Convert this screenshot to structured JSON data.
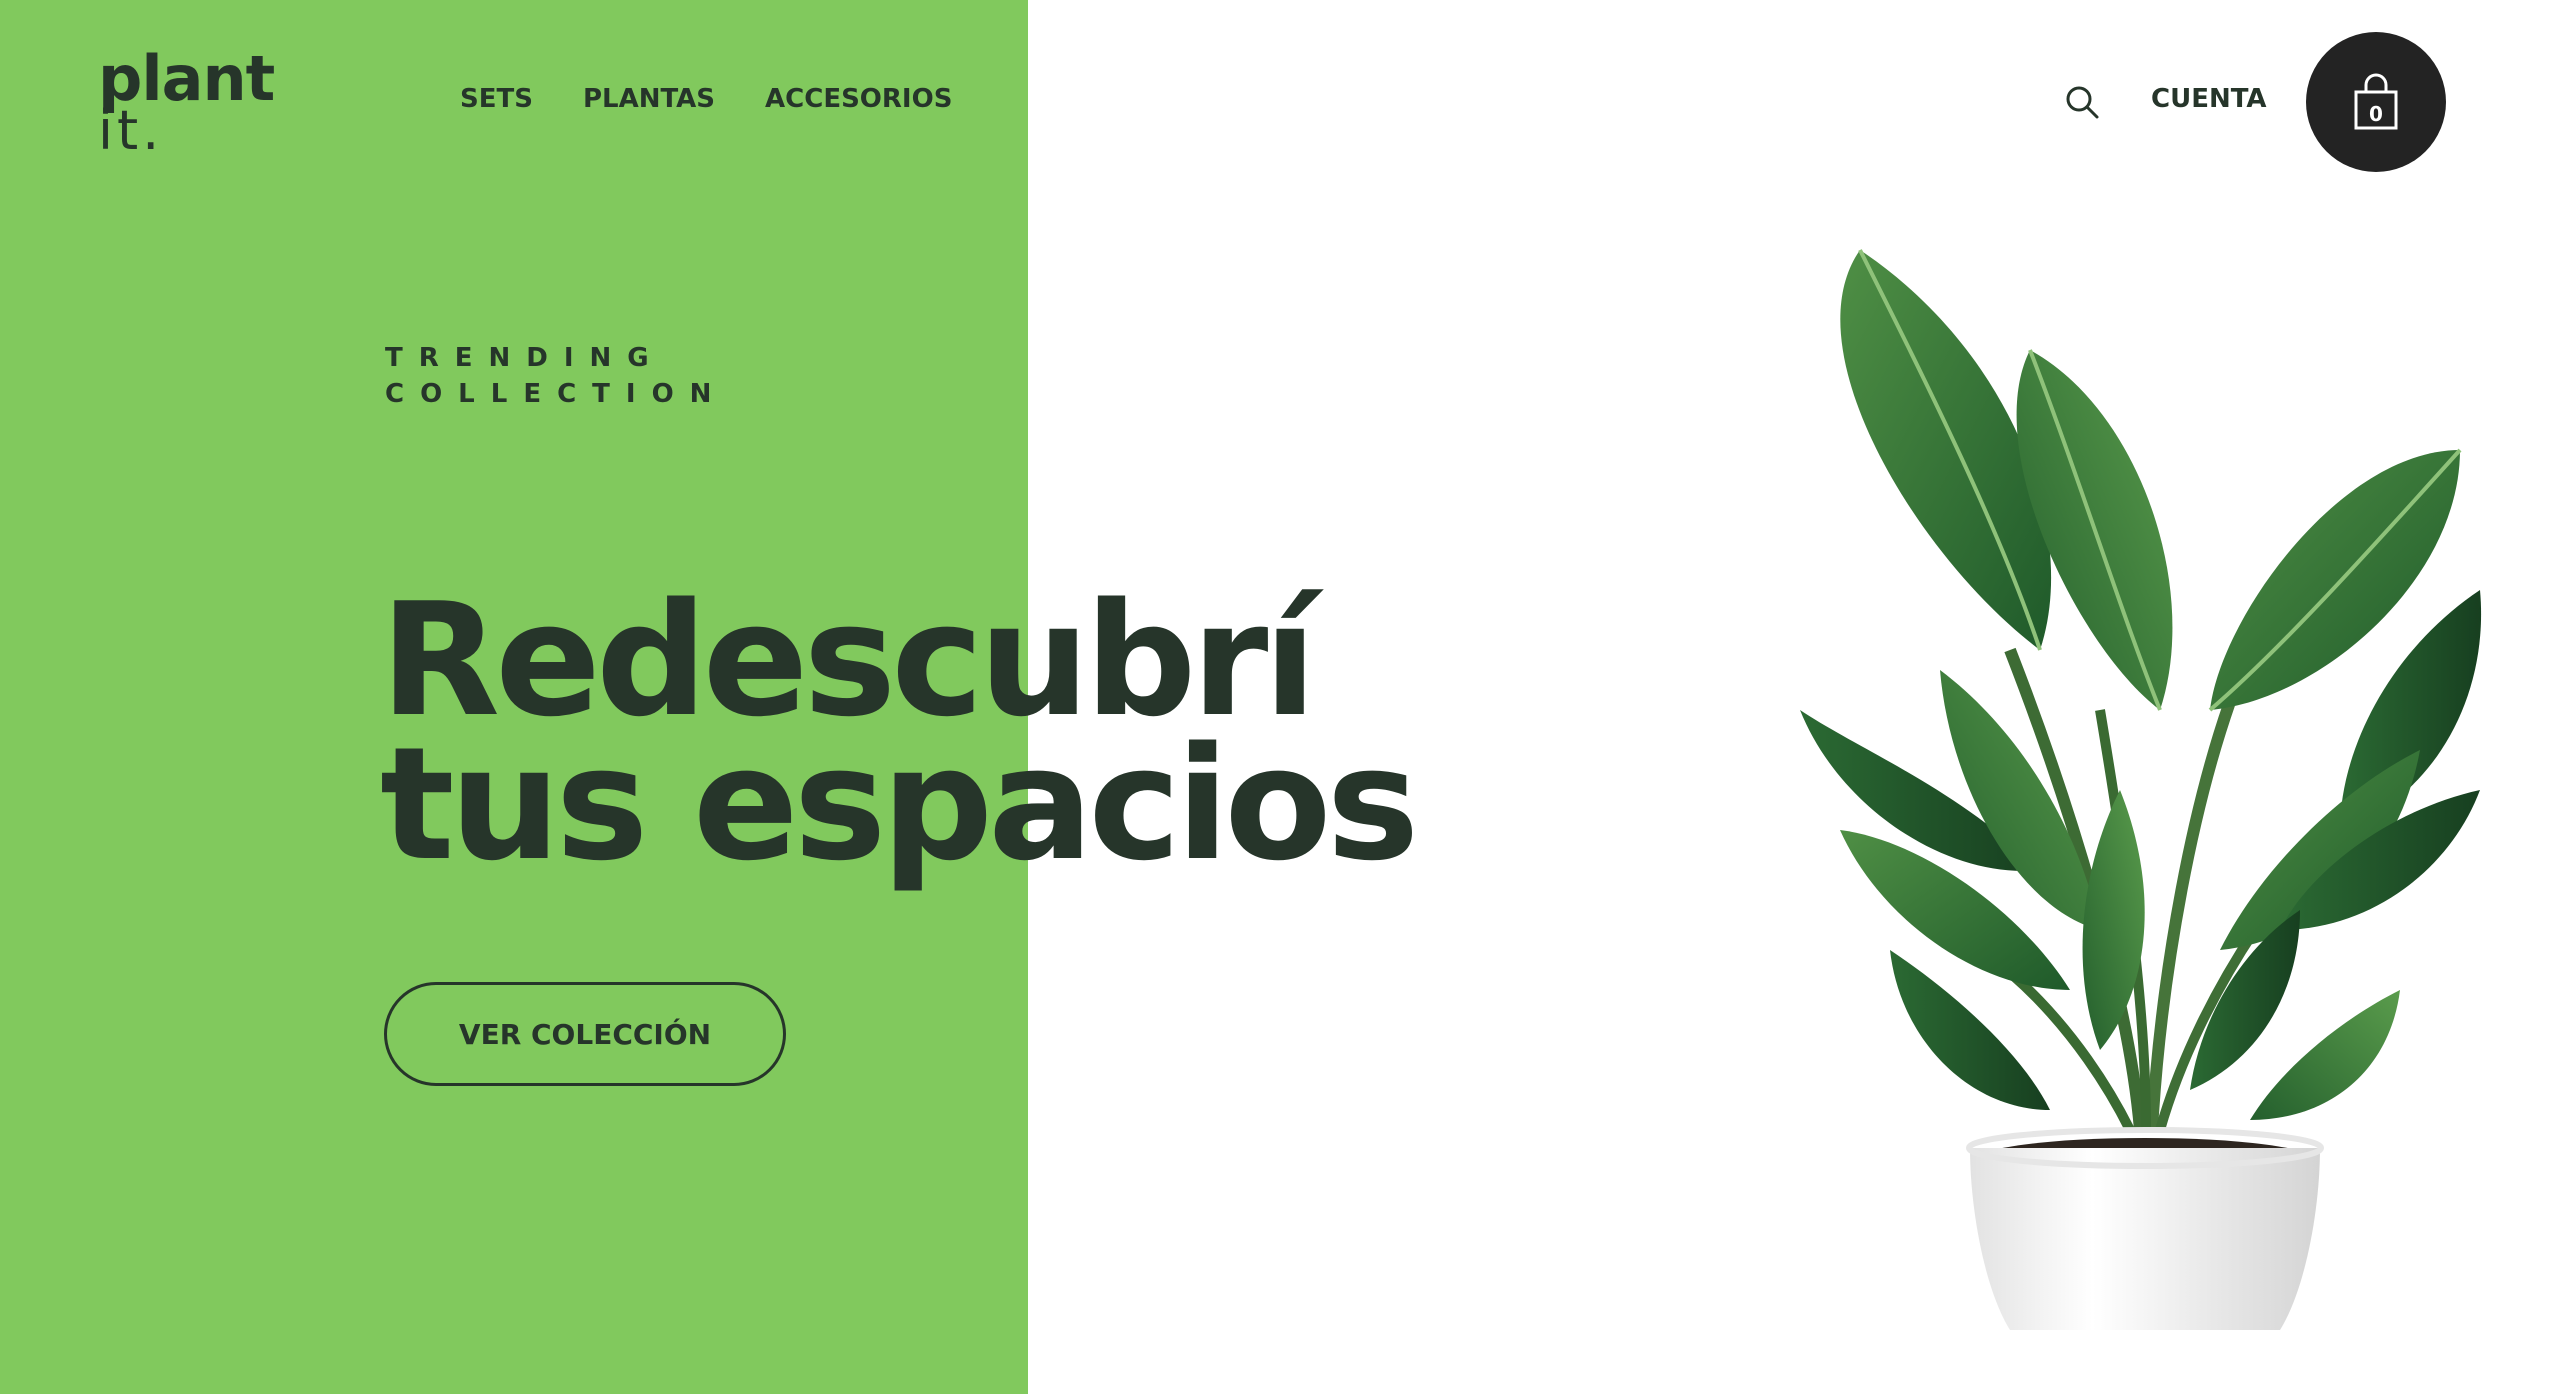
{
  "brand": {
    "logo_main": "plant",
    "logo_sub": "it."
  },
  "nav": {
    "items": [
      {
        "label": "SETS"
      },
      {
        "label": "PLANTAS"
      },
      {
        "label": "ACCESORIOS"
      }
    ]
  },
  "header": {
    "search_icon": "search-icon",
    "account_label": "CUENTA",
    "cart_icon": "shopping-bag-icon",
    "cart_count": "0"
  },
  "hero": {
    "eyebrow_line1": "TRENDING",
    "eyebrow_line2": "COLLECTION",
    "title_line1": "Redescubrí",
    "title_line2": "tus espacios",
    "cta_label": "VER COLECCIÓN",
    "image": "potted-plant-image"
  },
  "colors": {
    "panel_green": "#81c95d",
    "text_dark": "#26352a",
    "cart_bg": "#232323",
    "background": "#ffffff"
  }
}
